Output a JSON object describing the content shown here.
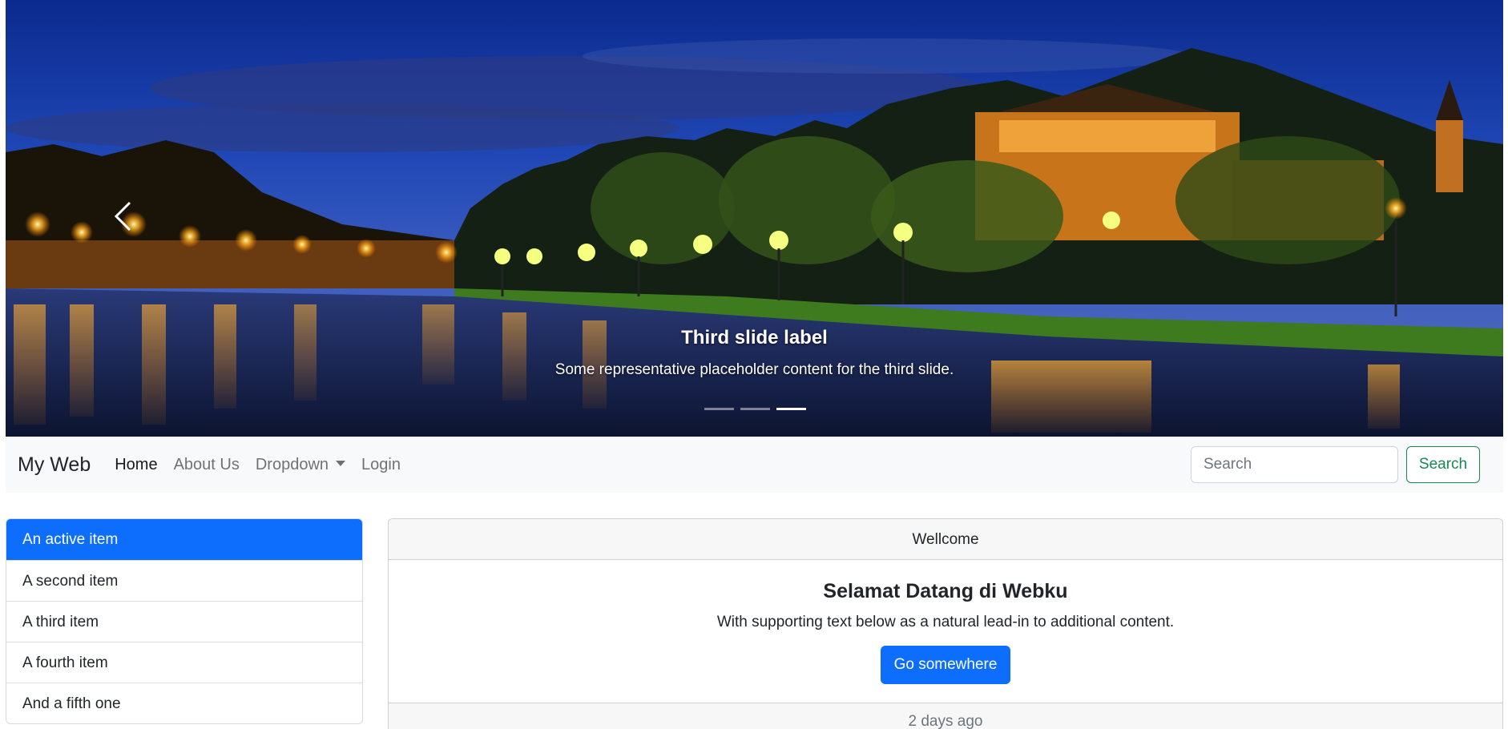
{
  "carousel": {
    "slide_title": "Third slide label",
    "slide_text": "Some representative placeholder content for the third slide.",
    "active_indicator": 3,
    "indicator_count": 3,
    "prev_icon": "chevron-left-icon"
  },
  "navbar": {
    "brand": "My Web",
    "links": [
      {
        "label": "Home",
        "active": true
      },
      {
        "label": "About Us",
        "active": false
      },
      {
        "label": "Dropdown",
        "active": false
      },
      {
        "label": "Login",
        "active": false
      }
    ],
    "search_placeholder": "Search",
    "search_button": "Search"
  },
  "sidebar": {
    "items": [
      {
        "label": "An active item",
        "active": true
      },
      {
        "label": "A second item",
        "active": false
      },
      {
        "label": "A third item",
        "active": false
      },
      {
        "label": "A fourth item",
        "active": false
      },
      {
        "label": "And a fifth one",
        "active": false
      }
    ]
  },
  "card": {
    "header": "Wellcome",
    "title": "Selamat Datang di Webku",
    "text": "With supporting text below as a natural lead-in to additional content.",
    "button": "Go somewhere",
    "footer": "2 days ago"
  },
  "colors": {
    "primary": "#0d6efd",
    "success": "#198754",
    "navbar_bg": "#f8f9fa"
  }
}
